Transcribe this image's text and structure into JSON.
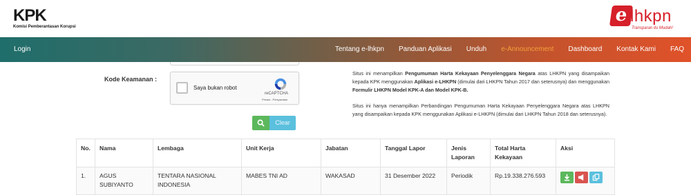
{
  "header": {
    "kpk_logo_text": "KPK",
    "kpk_subtitle": "Komisi Pemberantasan Korupsi",
    "elhkpn_e": "e",
    "elhkpn_text": "lhkpn",
    "elhkpn_tagline": "Transparan itu Mudah!"
  },
  "nav": {
    "login": "Login",
    "links": [
      "Tentang e-lhkpn",
      "Panduan Aplikasi",
      "Unduh",
      "e-Announcement",
      "Dashboard",
      "Kontak Kami",
      "FAQ"
    ],
    "active_index": 3
  },
  "form": {
    "kode_label": "Kode Keamanan :",
    "captcha_text": "Saya bukan robot",
    "captcha_brand": "reCAPTCHA",
    "captcha_privacy": "Privasi - Persyaratan",
    "clear_label": "Clear"
  },
  "info": {
    "p1_pre": "Situs ini menampilkan ",
    "p1_b1": "Pengumuman Harta Kekayaan Penyelenggara Negara",
    "p1_mid1": " atas LHKPN yang disampaikan kepada KPK menggunakan ",
    "p1_b2": "Aplikasi e-LHKPN",
    "p1_mid2": " (dimulai dari LHKPN Tahun 2017 dan seterusnya) dan menggunakan ",
    "p1_b3": "Formulir LHKPN Model KPK-A dan Model KPK-B.",
    "p2": "Situs ini hanya menampilkan Perbandingan Pengumuman Harta Kekayaan Penyelenggara Negara atas LHKPN yang disampaikan kepada KPK menggunakan Aplikasi e-LHKPN (dimulai dari LHKPN Tahun 2018 dan seterusnya)."
  },
  "table": {
    "headers": {
      "no": "No.",
      "nama": "Nama",
      "lembaga": "Lembaga",
      "unit": "Unit Kerja",
      "jabatan": "Jabatan",
      "tanggal": "Tanggal Lapor",
      "jenis": "Jenis Laporan",
      "total": "Total Harta Kekayaan",
      "aksi": "Aksi"
    },
    "rows": [
      {
        "no": "1.",
        "nama": "AGUS SUBIYANTO",
        "lembaga": "TENTARA NASIONAL INDONESIA",
        "unit": "MABES TNI AD",
        "jabatan": "WAKASAD",
        "tanggal": "31 Desember 2022",
        "jenis": "Periodik",
        "total": "Rp.19.338.276.593"
      }
    ],
    "actions": [
      "download-icon",
      "announce-icon",
      "compare-icon"
    ]
  },
  "colors": {
    "nav_start": "#1f6e6b",
    "nav_end": "#e0522a",
    "active_link": "#f5a03a",
    "brand_red": "#d6202a",
    "btn_green": "#5cb85c",
    "btn_red": "#d9534f",
    "btn_blue": "#5bc0de"
  }
}
